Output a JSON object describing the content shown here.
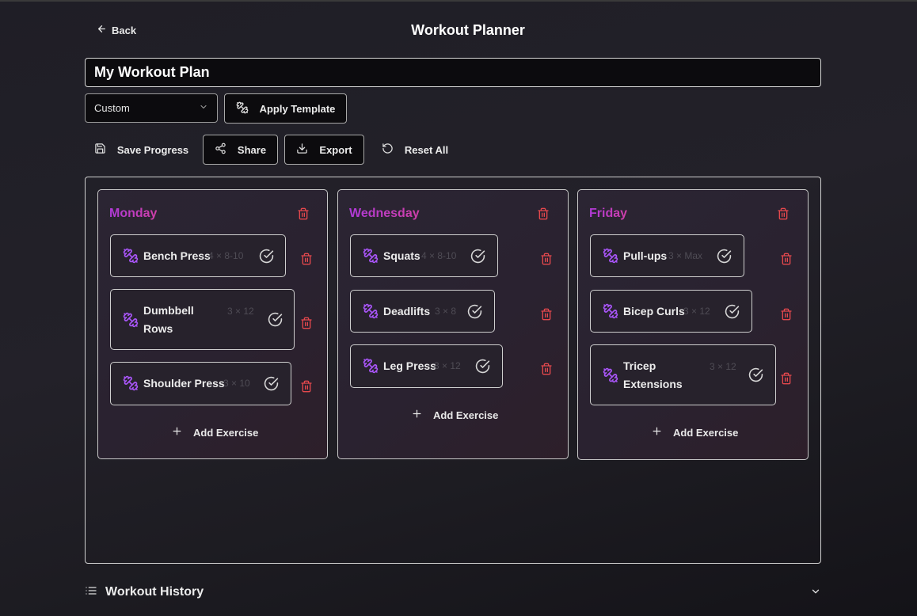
{
  "header": {
    "back_label": "Back",
    "title": "Workout Planner"
  },
  "plan": {
    "name": "My Workout Plan"
  },
  "template": {
    "selected": "Custom",
    "apply_label": "Apply Template"
  },
  "toolbar": {
    "save_label": "Save Progress",
    "share_label": "Share",
    "export_label": "Export",
    "reset_label": "Reset All"
  },
  "days": [
    {
      "name": "Monday",
      "exercises": [
        {
          "name": "Bench Press",
          "sets": "4 × 8-10"
        },
        {
          "name": "Dumbbell Rows",
          "sets": "3 × 12"
        },
        {
          "name": "Shoulder Press",
          "sets": "3 × 10"
        }
      ],
      "add_label": "Add Exercise"
    },
    {
      "name": "Wednesday",
      "exercises": [
        {
          "name": "Squats",
          "sets": "4 × 8-10"
        },
        {
          "name": "Deadlifts",
          "sets": "3 × 8"
        },
        {
          "name": "Leg Press",
          "sets": "3 × 12"
        }
      ],
      "add_label": "Add Exercise"
    },
    {
      "name": "Friday",
      "exercises": [
        {
          "name": "Pull-ups",
          "sets": "3 × Max"
        },
        {
          "name": "Bicep Curls",
          "sets": "3 × 12"
        },
        {
          "name": "Tricep Extensions",
          "sets": "3 × 12"
        }
      ],
      "add_label": "Add Exercise"
    }
  ],
  "history": {
    "label": "Workout History"
  },
  "colors": {
    "accent_purple": "#a855f7",
    "day_title_start": "#b03ad8",
    "day_title_end": "#cf3fa8",
    "danger": "#e5484d"
  },
  "icons": {
    "back": "arrow-left-icon",
    "select": "chevron-down-icon",
    "template": "dumbbell-icon",
    "save": "save-icon",
    "share": "share-icon",
    "export": "download-icon",
    "reset": "rotate-ccw-icon",
    "exercise": "dumbbell-icon",
    "complete": "check-circle-icon",
    "delete": "trash-icon",
    "add": "plus-icon",
    "history": "list-icon",
    "expand": "chevron-down-icon"
  }
}
